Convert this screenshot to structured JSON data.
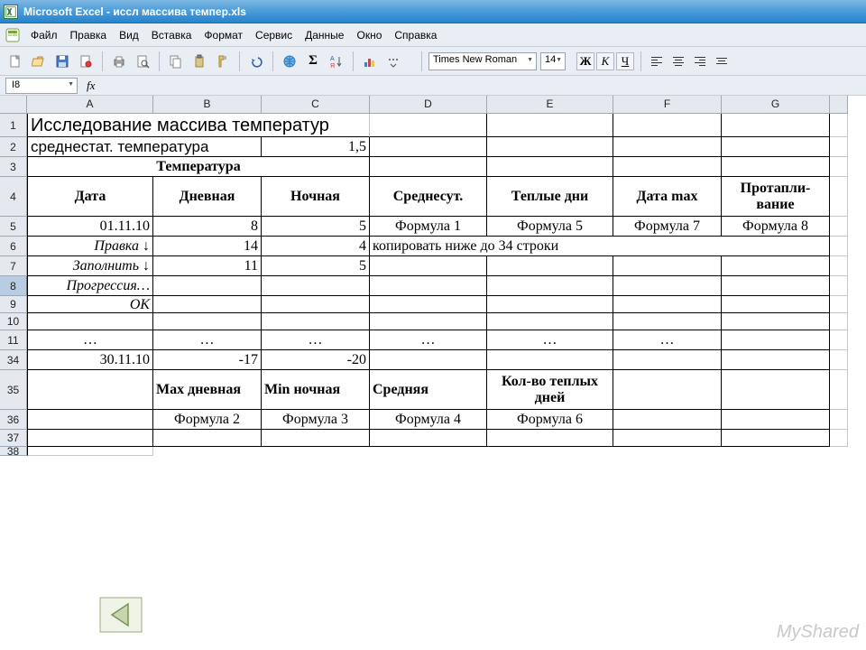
{
  "titlebar": {
    "text": "Microsoft Excel - иссл массива темпер.xls"
  },
  "menu": {
    "file": "Файл",
    "edit": "Правка",
    "view": "Вид",
    "insert": "Вставка",
    "format": "Формат",
    "service": "Сервис",
    "data": "Данные",
    "window": "Окно",
    "help": "Справка"
  },
  "toolbar": {
    "font_name": "Times New Roman",
    "font_size": "14",
    "bold": "Ж",
    "italic": "К",
    "underline": "Ч"
  },
  "fxbar": {
    "namebox": "I8",
    "fx": "fx"
  },
  "columns": {
    "A": "A",
    "B": "B",
    "C": "C",
    "D": "D",
    "E": "E",
    "F": "F",
    "G": "G"
  },
  "rows": {
    "r1": "1",
    "r2": "2",
    "r3": "3",
    "r4": "4",
    "r5": "5",
    "r6": "6",
    "r7": "7",
    "r8": "8",
    "r9": "9",
    "r10": "10",
    "r11": "11",
    "r34": "34",
    "r35": "35",
    "r36": "36",
    "r37": "37",
    "r38": "38"
  },
  "cells": {
    "title": "Исследование массива температур",
    "avg_label": "среднестат. температура",
    "avg_val": "1,5",
    "temp_header": "Температура",
    "h_date": "Дата",
    "h_day": "Дневная",
    "h_night": "Ночная",
    "h_avg_day": "Среднесут.",
    "h_warm": "Теплые дни",
    "h_max": "Дата max",
    "h_heat": "Протапли-\nвание",
    "d5_A": "01.11.10",
    "d5_B": "8",
    "d5_C": "5",
    "d5_D": "Формула 1",
    "d5_E": "Формула 5",
    "d5_F": "Формула 7",
    "d5_G": "Формула 8",
    "d6_A": "Правка ↓",
    "d6_B": "14",
    "d6_C": "4",
    "d6_D": "копировать ниже до 34 строки",
    "d7_A": "Заполнить ↓",
    "d7_B": "11",
    "d7_C": "5",
    "d8_A": "Прогрессия…",
    "d9_A": "ОК",
    "ell": "…",
    "d34_A": "30.11.10",
    "d34_B": "-17",
    "d34_C": "-20",
    "d35_B": "Max дневная",
    "d35_C": "Min ночная",
    "d35_D": "Средняя",
    "d35_E": "Кол-во теплых дней",
    "d36_B": "Формула 2",
    "d36_C": "Формула 3",
    "d36_D": "Формула 4",
    "d36_E": "Формула 6"
  },
  "watermark": "MyShared"
}
